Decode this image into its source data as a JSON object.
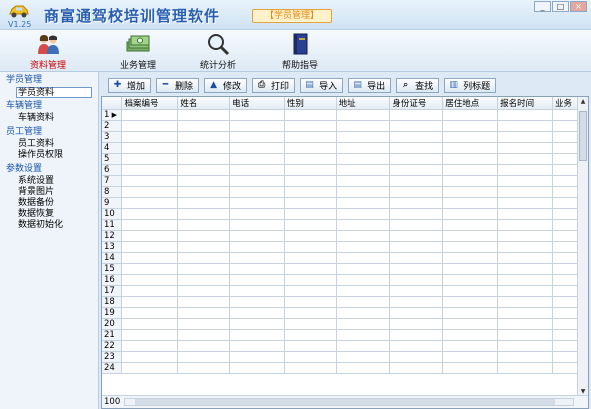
{
  "window": {
    "title": "商富通驾校培训管理软件",
    "badge": "【学员管理】",
    "version": "V1.25",
    "controls": [
      "_",
      "□",
      "×"
    ]
  },
  "topnav": [
    {
      "label": "资料管理",
      "icon": "people-icon",
      "active": true
    },
    {
      "label": "业务管理",
      "icon": "money-icon",
      "active": false
    },
    {
      "label": "统计分析",
      "icon": "magnifier-icon",
      "active": false
    },
    {
      "label": "帮助指导",
      "icon": "book-icon",
      "active": false
    }
  ],
  "sidebar": {
    "groups": [
      {
        "title": "学员管理",
        "items": [
          "学员资料"
        ]
      },
      {
        "title": "车辆管理",
        "items": [
          "车辆资料"
        ]
      },
      {
        "title": "员工管理",
        "items": [
          "员工资料",
          "操作员权限"
        ]
      },
      {
        "title": "参数设置",
        "items": [
          "系统设置",
          "背景图片",
          "数据备份",
          "数据恢复",
          "数据初始化"
        ]
      }
    ],
    "active_item": "学员资料"
  },
  "toolbar": {
    "add": "增加",
    "delete": "删除",
    "edit": "修改",
    "print": "打印",
    "import": "导入",
    "export": "导出",
    "find": "查找",
    "columns": "列标题"
  },
  "grid": {
    "columns": [
      "档案编号",
      "姓名",
      "电话",
      "性别",
      "地址",
      "身份证号",
      "居住地点",
      "报名时间",
      "业务"
    ],
    "row_numbers": [
      "1",
      "2",
      "3",
      "4",
      "5",
      "6",
      "7",
      "8",
      "9",
      "10",
      "11",
      "12",
      "13",
      "14",
      "15",
      "16",
      "17",
      "18",
      "19",
      "20",
      "21",
      "22",
      "23",
      "24"
    ],
    "record_count": "100"
  },
  "colors": {
    "title": "#2a5fb0",
    "badge": "#e28a10",
    "sidebar_group": "#1b56a8",
    "active_nav": "#cc0000"
  }
}
